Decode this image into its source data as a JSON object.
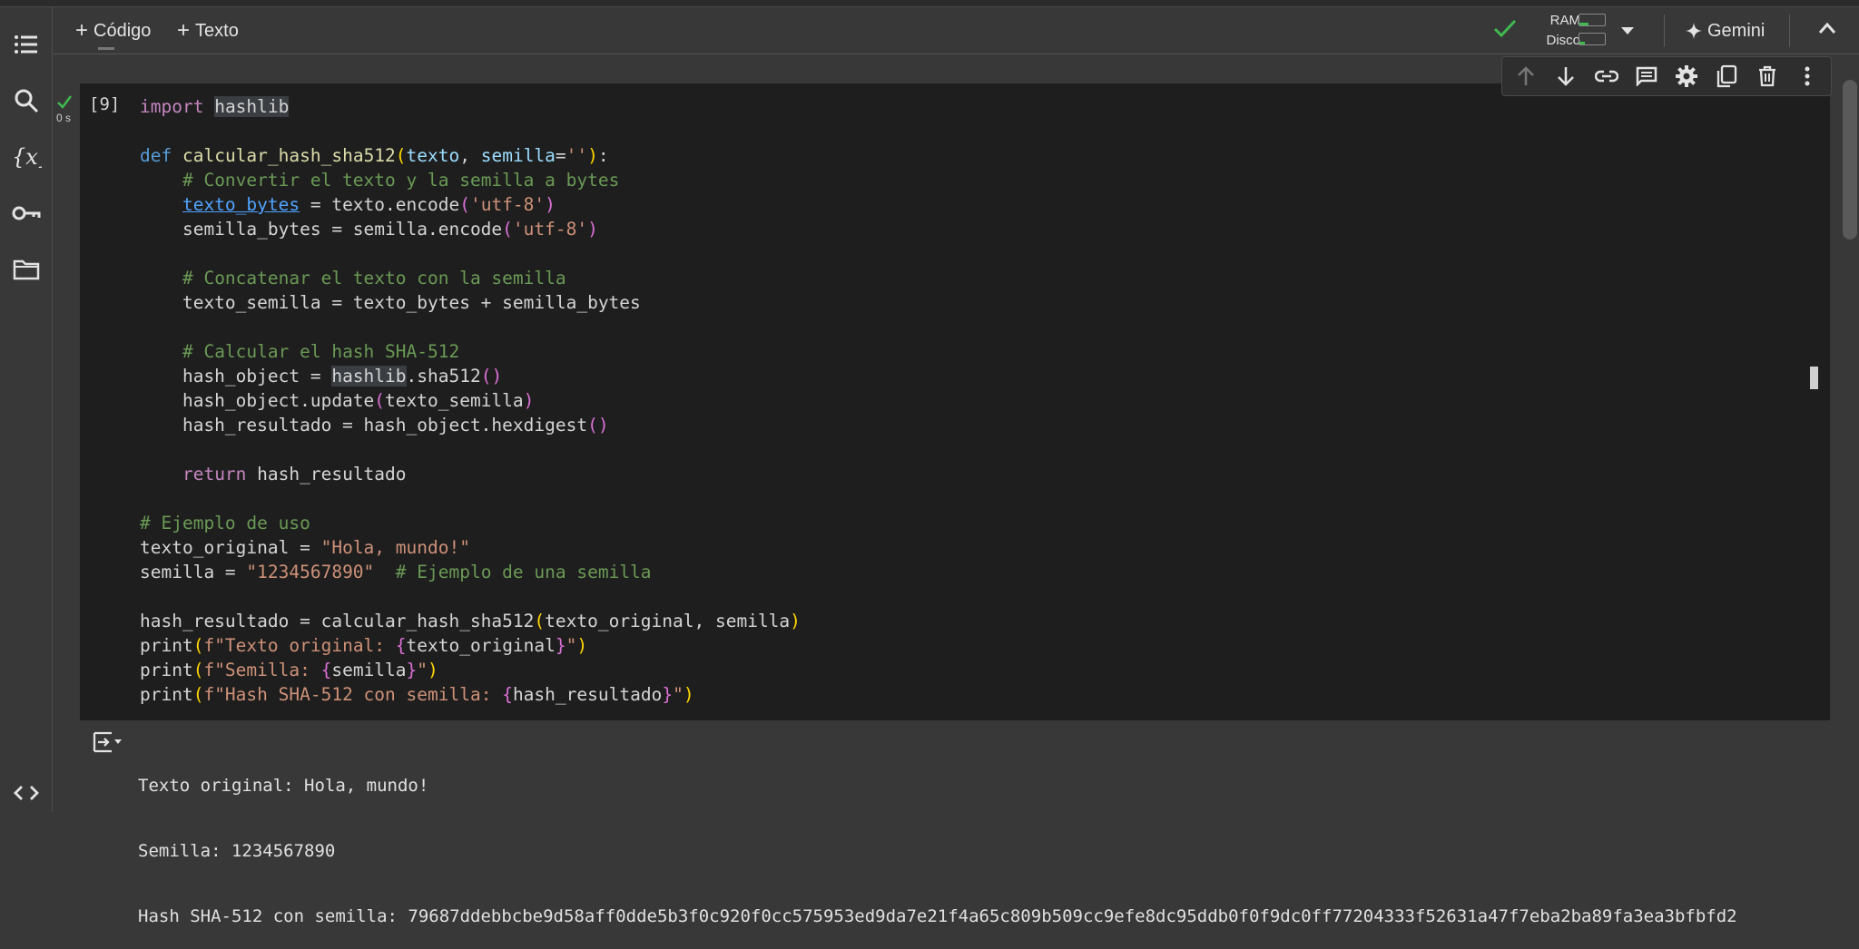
{
  "toolbar": {
    "add_code_label": "Código",
    "add_text_label": "Texto",
    "ram_label": "RAM",
    "disk_label": "Disco",
    "gemini_label": "Gemini"
  },
  "sidebar": {
    "icons": [
      "table-of-contents-icon",
      "search-icon",
      "variables-icon",
      "key-icon",
      "folder-icon",
      "code-snippets-icon"
    ]
  },
  "cell": {
    "exec_count": "[9]",
    "exec_time": "0 s",
    "status": "success",
    "lines": [
      [
        [
          "kw2",
          "import"
        ],
        [
          "",
          " "
        ],
        [
          "hl",
          "hashlib"
        ]
      ],
      [],
      [
        [
          "kw",
          "def"
        ],
        [
          "",
          " "
        ],
        [
          "fn",
          "calcular_hash_sha512"
        ],
        [
          "br",
          "("
        ],
        [
          "var",
          "texto"
        ],
        [
          "",
          ", "
        ],
        [
          "var",
          "semilla"
        ],
        [
          "",
          "="
        ],
        [
          "str",
          "''"
        ],
        [
          "br",
          ")"
        ],
        [
          "",
          ":"
        ]
      ],
      [
        [
          "",
          "    "
        ],
        [
          "cm",
          "# Convertir el texto y la semilla a bytes"
        ]
      ],
      [
        [
          "",
          "    "
        ],
        [
          "ul",
          "texto_bytes"
        ],
        [
          "",
          " = texto.encode"
        ],
        [
          "br2",
          "("
        ],
        [
          "str",
          "'utf-8'"
        ],
        [
          "br2",
          ")"
        ]
      ],
      [
        [
          "",
          "    semilla_bytes = semilla.encode"
        ],
        [
          "br2",
          "("
        ],
        [
          "str",
          "'utf-8'"
        ],
        [
          "br2",
          ")"
        ]
      ],
      [],
      [
        [
          "",
          "    "
        ],
        [
          "cm",
          "# Concatenar el texto con la semilla"
        ]
      ],
      [
        [
          "",
          "    texto_semilla = texto_bytes + semilla_bytes"
        ]
      ],
      [],
      [
        [
          "",
          "    "
        ],
        [
          "cm",
          "# Calcular el hash SHA-512"
        ]
      ],
      [
        [
          "",
          "    hash_object = "
        ],
        [
          "hl",
          "hashlib"
        ],
        [
          "",
          ".sha512"
        ],
        [
          "br2",
          "()"
        ]
      ],
      [
        [
          "",
          "    hash_object.update"
        ],
        [
          "br2",
          "("
        ],
        [
          "",
          "texto_semilla"
        ],
        [
          "br2",
          ")"
        ]
      ],
      [
        [
          "",
          "    hash_resultado = hash_object.hexdigest"
        ],
        [
          "br2",
          "()"
        ]
      ],
      [],
      [
        [
          "",
          "    "
        ],
        [
          "kw2",
          "return"
        ],
        [
          "",
          " hash_resultado"
        ]
      ],
      [],
      [
        [
          "cm",
          "# Ejemplo de uso"
        ]
      ],
      [
        [
          "",
          "texto_original = "
        ],
        [
          "str",
          "\"Hola, mundo!\""
        ]
      ],
      [
        [
          "",
          "semilla = "
        ],
        [
          "str",
          "\"1234567890\""
        ],
        [
          "",
          "  "
        ],
        [
          "cm",
          "# Ejemplo de una semilla"
        ]
      ],
      [],
      [
        [
          "",
          "hash_resultado = calcular_hash_sha512"
        ],
        [
          "br",
          "("
        ],
        [
          "",
          "texto_original, semilla"
        ],
        [
          "br",
          ")"
        ]
      ],
      [
        [
          "",
          "print"
        ],
        [
          "br",
          "("
        ],
        [
          "str",
          "f\"Texto original: "
        ],
        [
          "br2",
          "{"
        ],
        [
          "",
          "texto_original"
        ],
        [
          "br2",
          "}"
        ],
        [
          "str",
          "\""
        ],
        [
          "br",
          ")"
        ]
      ],
      [
        [
          "",
          "print"
        ],
        [
          "br",
          "("
        ],
        [
          "str",
          "f\"Semilla: "
        ],
        [
          "br2",
          "{"
        ],
        [
          "",
          "semilla"
        ],
        [
          "br2",
          "}"
        ],
        [
          "str",
          "\""
        ],
        [
          "br",
          ")"
        ]
      ],
      [
        [
          "",
          "print"
        ],
        [
          "br",
          "("
        ],
        [
          "str",
          "f\"Hash SHA-512 con semilla: "
        ],
        [
          "br2",
          "{"
        ],
        [
          "",
          "hash_resultado"
        ],
        [
          "br2",
          "}"
        ],
        [
          "str",
          "\""
        ],
        [
          "br",
          ")"
        ]
      ]
    ]
  },
  "cell_toolbar": {
    "icons": [
      "move-up-icon",
      "move-down-icon",
      "link-icon",
      "comment-icon",
      "settings-icon",
      "mirror-cell-icon",
      "delete-icon",
      "more-options-icon"
    ]
  },
  "output": {
    "lines": [
      "Texto original: Hola, mundo!",
      "Semilla: 1234567890",
      "Hash SHA-512 con semilla: 79687ddebbcbe9d58aff0dde5b3f0c920f0cc575953ed9da7e21f4a65c809b509cc9efe8dc95ddb0f0f9dc0ff77204333f52631a47f7eba2ba89fa3ea3bfbfd2"
    ]
  },
  "colors": {
    "background": "#383838",
    "editor": "#1e1e1e",
    "success": "#3fb950",
    "keyword": "#569cd6",
    "string": "#ce9178",
    "comment": "#6a9955"
  }
}
